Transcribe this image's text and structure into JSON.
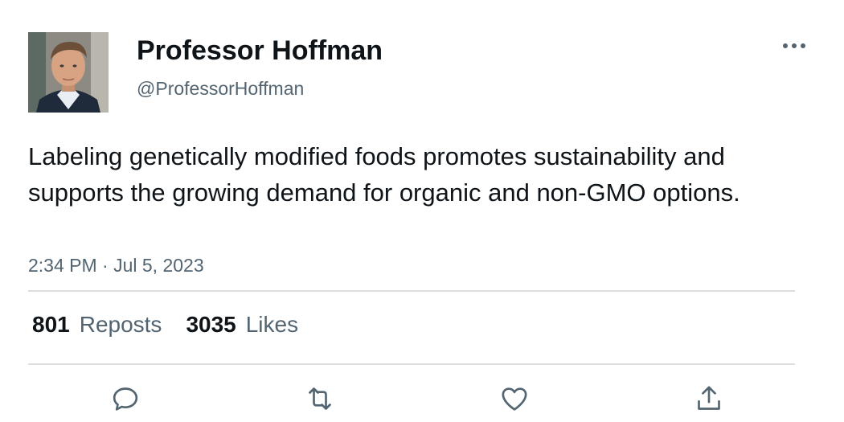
{
  "author": {
    "display_name": "Professor Hoffman",
    "handle": "@ProfessorHoffman",
    "avatar_icon": "profile-photo"
  },
  "tweet": {
    "text": "Labeling genetically modified foods promotes sustainability and supports the growing demand for organic and non-GMO options.",
    "timestamp": "2:34 PM · Jul 5, 2023"
  },
  "stats": {
    "reposts_count": "801",
    "reposts_label": "Reposts",
    "likes_count": "3035",
    "likes_label": "Likes"
  },
  "actions": {
    "reply_icon": "reply-icon",
    "repost_icon": "repost-icon",
    "like_icon": "heart-icon",
    "share_icon": "share-icon",
    "more_icon": "more-icon"
  },
  "colors": {
    "text_primary": "#0f1419",
    "text_secondary": "#536471",
    "divider": "#dcdfe2"
  }
}
